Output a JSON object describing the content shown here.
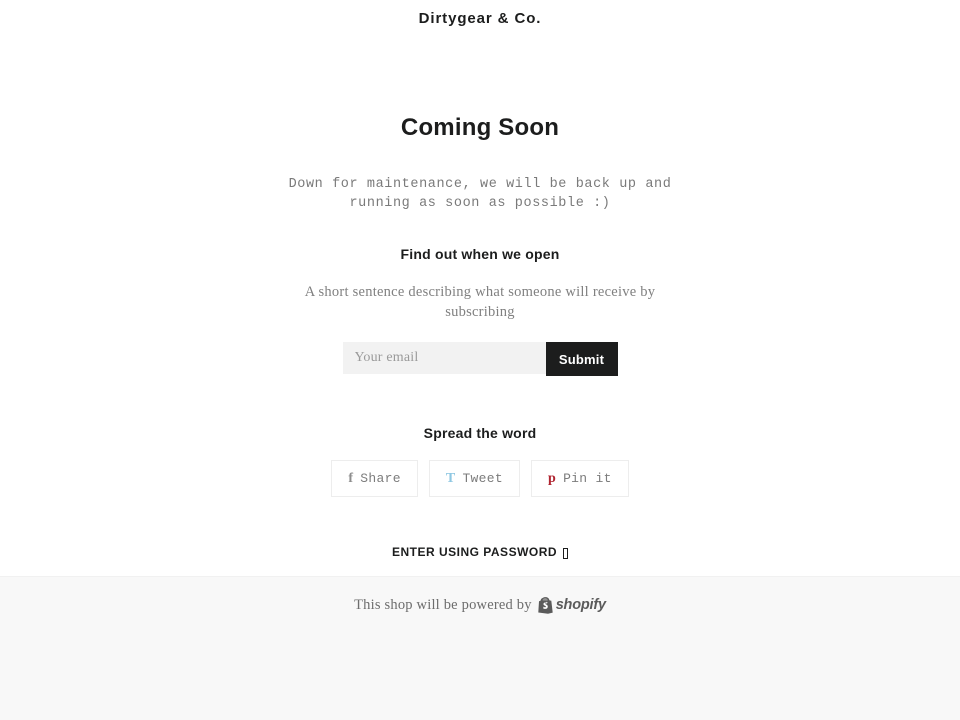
{
  "header": {
    "shop_title": "Dirtygear & Co."
  },
  "main": {
    "heading": "Coming Soon",
    "maintenance_message": "Down for maintenance, we will be back up and running as soon as possible :)"
  },
  "newsletter": {
    "heading": "Find out when we open",
    "subtext": "A short sentence describing what someone will receive by subscribing",
    "email_placeholder": "Your email",
    "email_value": "",
    "submit_label": "Submit"
  },
  "social": {
    "heading": "Spread the word",
    "buttons": [
      {
        "glyph": "f",
        "label": "Share",
        "icon_name": "facebook-icon",
        "color": "#8d8d8d"
      },
      {
        "glyph": "T",
        "label": "Tweet",
        "icon_name": "twitter-icon",
        "color": "#8ec7e2"
      },
      {
        "glyph": "p",
        "label": "Pin it",
        "icon_name": "pinterest-icon",
        "color": "#b02430"
      }
    ]
  },
  "password": {
    "link_label": "ENTER USING PASSWORD",
    "lock_glyph": "▯"
  },
  "footer": {
    "powered_by_text": "This shop will be powered by",
    "brand_name": "shopify"
  },
  "colors": {
    "page_background": "#ffffff",
    "footer_background": "#f8f8f8",
    "text_primary": "#1c1d1d",
    "text_muted": "#7a7a7a",
    "input_background": "#f2f2f2",
    "button_background": "#1c1d1d",
    "border_light": "#ededed"
  }
}
